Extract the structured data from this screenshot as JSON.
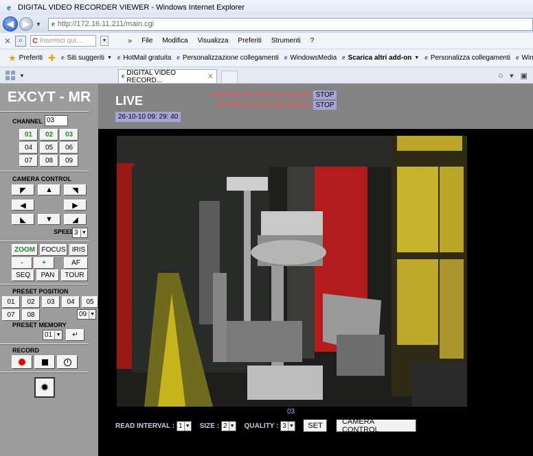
{
  "browser": {
    "window_title": "DIGITAL VIDEO RECORDER VIEWER - Windows Internet Explorer",
    "address": "http://172.16.11.211/main.cgi",
    "search_placeholder": "Inserisci qui...",
    "menu": [
      "File",
      "Modifica",
      "Visualizza",
      "Preferiti",
      "Strumenti",
      "?"
    ],
    "favorites_label": "Preferiti",
    "favorites": [
      {
        "label": "Siti suggeriti",
        "dropdown": true,
        "bold": false
      },
      {
        "label": "HotMail gratuita",
        "dropdown": false,
        "bold": false
      },
      {
        "label": "Personalizzazione collegamenti",
        "dropdown": false,
        "bold": false
      },
      {
        "label": "WindowsMedia",
        "dropdown": false,
        "bold": false
      },
      {
        "label": "Scarica altri add-on",
        "dropdown": true,
        "bold": true
      },
      {
        "label": "Personalizza collegamenti",
        "dropdown": false,
        "bold": false
      },
      {
        "label": "Windows",
        "dropdown": false,
        "bold": false
      }
    ],
    "active_tab": "DIGITAL VIDEO RECORD..."
  },
  "panel": {
    "brand": "EXCYT - MR",
    "channel_label": "CHANNEL",
    "channel_value": "03",
    "channels": [
      "01",
      "02",
      "03",
      "04",
      "05",
      "06",
      "07",
      "08",
      "09"
    ],
    "active_channels": [
      "01",
      "02",
      "03"
    ],
    "camera_control_label": "CAMERA CONTROL",
    "speed_label": "SPEED",
    "speed_value": "3",
    "lens_buttons": [
      {
        "label": "ZOOM",
        "active": true
      },
      {
        "label": "FOCUS",
        "active": false
      },
      {
        "label": "IRIS",
        "active": false
      },
      {
        "label": "-",
        "active": true
      },
      {
        "label": "+",
        "active": true
      },
      {
        "label": "AF",
        "active": false
      },
      {
        "label": "SEQ",
        "active": false
      },
      {
        "label": "PAN",
        "active": false
      },
      {
        "label": "TOUR",
        "active": false
      }
    ],
    "preset_position_label": "PRESET POSITION",
    "presets": [
      "01",
      "02",
      "03",
      "04",
      "05",
      "07",
      "08"
    ],
    "preset_select": "09",
    "preset_memory_label": "PRESET MEMORY",
    "preset_memory_value": "01",
    "record_label": "RECORD"
  },
  "live": {
    "title": "LIVE",
    "datetime": "26-10-10  09: 29: 40",
    "normal_mode_label": "NORMAL RECORDING MODE",
    "normal_mode_status": "STOP",
    "alarm_mode_label": "ALARM RECORDING MODE",
    "alarm_mode_status": "STOP",
    "camera_label": "03",
    "read_interval_label": "READ INTERVAL :",
    "read_interval_value": "1",
    "size_label": "SIZE :",
    "size_value": "2",
    "quality_label": "QUALITY :",
    "quality_value": "3",
    "set_button": "SET",
    "camera_control_button": "CAMERA CONTROL"
  },
  "colors": {
    "panel_bg": "#9c9c9c",
    "header_bg": "#838383",
    "mode_label": "#ff5454",
    "badge_bg": "#a7a5d8",
    "active_green": "#1f8a2c"
  }
}
